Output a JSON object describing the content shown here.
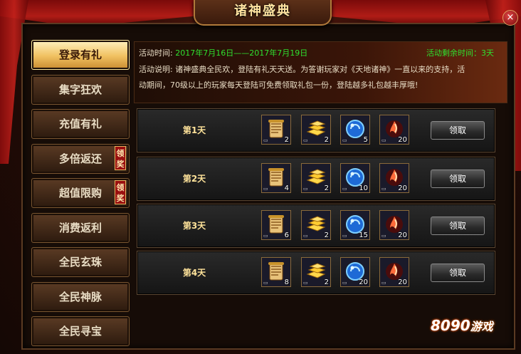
{
  "window": {
    "title": "诸神盛典",
    "close_icon": "×"
  },
  "sidebar": {
    "items": [
      {
        "label": "登录有礼",
        "active": true,
        "badge": ""
      },
      {
        "label": "集字狂欢",
        "active": false,
        "badge": ""
      },
      {
        "label": "充值有礼",
        "active": false,
        "badge": ""
      },
      {
        "label": "多倍返还",
        "active": false,
        "badge": "领奖"
      },
      {
        "label": "超值限购",
        "active": false,
        "badge": "领奖"
      },
      {
        "label": "消费返利",
        "active": false,
        "badge": ""
      },
      {
        "label": "全民玄珠",
        "active": false,
        "badge": ""
      },
      {
        "label": "全民神脉",
        "active": false,
        "badge": ""
      },
      {
        "label": "全民寻宝",
        "active": false,
        "badge": ""
      }
    ]
  },
  "info": {
    "time_label": "活动时间:",
    "time_value": "2017年7月16日——2017年7月19日",
    "remaining_label": "活动剩余时间：",
    "remaining_value": "3天",
    "desc_label": "活动说明:",
    "desc_line1": "诸神盛典全民欢，登陆有礼天天送。为答谢玩家对《天地诸神》一直以来的支持，活",
    "desc_line2": "动期间，70级以上的玩家每天登陆可免费领取礼包一份，登陆越多礼包越丰厚哦!"
  },
  "rewards": [
    {
      "day": "第1天",
      "counts": [
        "2",
        "2",
        "5",
        "20"
      ],
      "button": "领取"
    },
    {
      "day": "第2天",
      "counts": [
        "4",
        "2",
        "10",
        "20"
      ],
      "button": "领取"
    },
    {
      "day": "第3天",
      "counts": [
        "6",
        "2",
        "15",
        "20"
      ],
      "button": "领取"
    },
    {
      "day": "第4天",
      "counts": [
        "8",
        "2",
        "20",
        "20"
      ],
      "button": "领取"
    }
  ],
  "item_icons": [
    "scroll-icon",
    "gold-bar-icon",
    "blue-orb-icon",
    "red-flame-orb-icon"
  ],
  "watermark": {
    "number": "8090",
    "text": "游戏"
  }
}
